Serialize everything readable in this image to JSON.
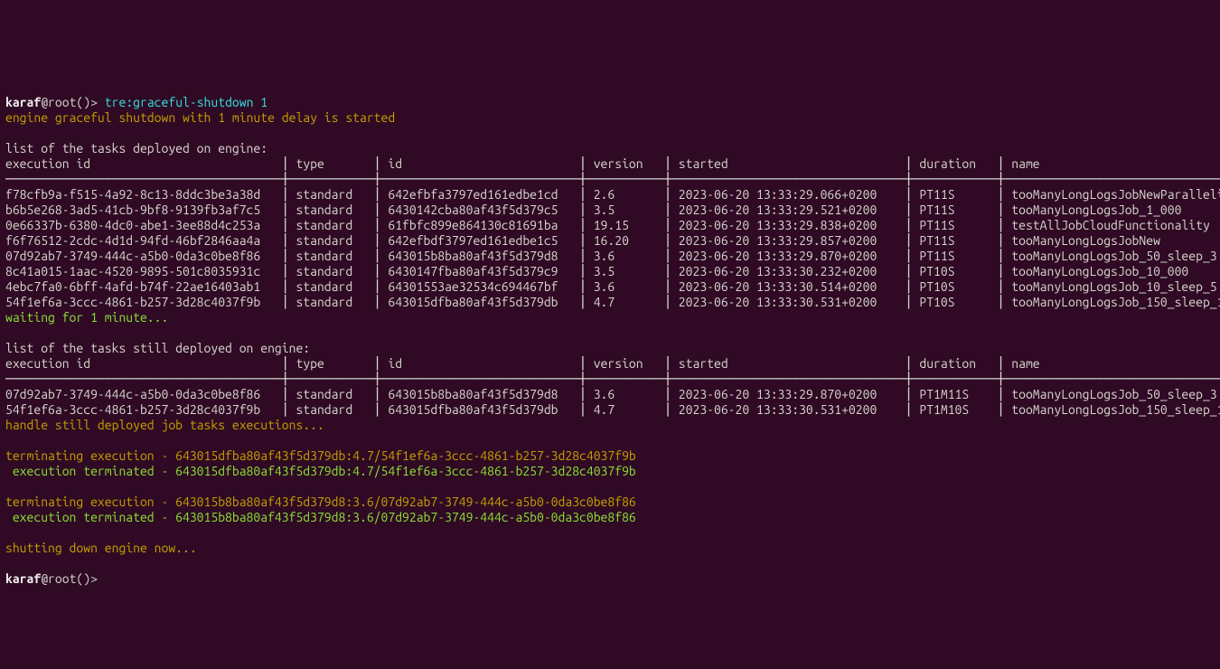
{
  "prompt": {
    "user": "karaf",
    "at": "@",
    "host": "root",
    "suffix": "()>",
    "space": " "
  },
  "cmd": {
    "text": "tre:graceful-shutdown",
    "arg": "1"
  },
  "msg": {
    "start": "engine graceful shutdown with 1 minute delay is started",
    "list1": "list of the tasks deployed on engine:",
    "waiting": "waiting for 1 minute...",
    "list2": "list of the tasks still deployed on engine:",
    "handle": "handle still deployed job tasks executions...",
    "term1a": "terminating execution - 643015dfba80af43f5d379db:4.7/54f1ef6a-3ccc-4861-b257-3d28c4037f9b",
    "term1b": " execution terminated - 643015dfba80af43f5d379db:4.7/54f1ef6a-3ccc-4861-b257-3d28c4037f9b",
    "term2a": "terminating execution - 643015b8ba80af43f5d379d8:3.6/07d92ab7-3749-444c-a5b0-0da3c0be8f86",
    "term2b": " execution terminated - 643015b8ba80af43f5d379d8:3.6/07d92ab7-3749-444c-a5b0-0da3c0be8f86",
    "shutting": "shutting down engine now..."
  },
  "hdr": {
    "exec": "execution id",
    "type": "type",
    "id": "id",
    "ver": "version",
    "started": "started",
    "dur": "duration",
    "name": "name"
  },
  "sep": {
    "long": "───────────────────────────────────────┼────────────┼────────────────────────────┼───────────┼─────────────────────────────────┼────────────┼──────────────────────────────────────",
    "tbl2": "───────────────────────────────────────┼────────────┼────────────────────────────┼───────────┼─────────────────────────────────┼────────────┼──────────────────────────────────────"
  },
  "t1": [
    {
      "exec": "f78cfb9a-f515-4a92-8c13-8ddc3be3a38d",
      "type": "standard",
      "id": "642efbfa3797ed161edbe1cd",
      "ver": "2.6",
      "started": "2023-06-20 13:33:29.066+0200",
      "dur": "PT11S",
      "name": "tooManyLongLogsJobNewParallelizeParent"
    },
    {
      "exec": "b6b5e268-3ad5-41cb-9bf8-9139fb3af7c5",
      "type": "standard",
      "id": "6430142cba80af43f5d379c5",
      "ver": "3.5",
      "started": "2023-06-20 13:33:29.521+0200",
      "dur": "PT11S",
      "name": "tooManyLongLogsJob_1_000"
    },
    {
      "exec": "0e66337b-6380-4dc0-abe1-3ee88d4c253a",
      "type": "standard",
      "id": "61fbfc899e864130c81691ba",
      "ver": "19.15",
      "started": "2023-06-20 13:33:29.838+0200",
      "dur": "PT11S",
      "name": "testAllJobCloudFunctionality"
    },
    {
      "exec": "f6f76512-2cdc-4d1d-94fd-46bf2846aa4a",
      "type": "standard",
      "id": "642efbdf3797ed161edbe1c5",
      "ver": "16.20",
      "started": "2023-06-20 13:33:29.857+0200",
      "dur": "PT11S",
      "name": "tooManyLongLogsJobNew"
    },
    {
      "exec": "07d92ab7-3749-444c-a5b0-0da3c0be8f86",
      "type": "standard",
      "id": "643015b8ba80af43f5d379d8",
      "ver": "3.6",
      "started": "2023-06-20 13:33:29.870+0200",
      "dur": "PT11S",
      "name": "tooManyLongLogsJob_50_sleep_3"
    },
    {
      "exec": "8c41a015-1aac-4520-9895-501c8035931c",
      "type": "standard",
      "id": "6430147fba80af43f5d379c9",
      "ver": "3.5",
      "started": "2023-06-20 13:33:30.232+0200",
      "dur": "PT10S",
      "name": "tooManyLongLogsJob_10_000"
    },
    {
      "exec": "4ebc7fa0-6bff-4afd-b74f-22ae16403ab1",
      "type": "standard",
      "id": "64301553ae32534c694467bf",
      "ver": "3.6",
      "started": "2023-06-20 13:33:30.514+0200",
      "dur": "PT10S",
      "name": "tooManyLongLogsJob_10_sleep_5"
    },
    {
      "exec": "54f1ef6a-3ccc-4861-b257-3d28c4037f9b",
      "type": "standard",
      "id": "643015dfba80af43f5d379db",
      "ver": "4.7",
      "started": "2023-06-20 13:33:30.531+0200",
      "dur": "PT10S",
      "name": "tooManyLongLogsJob_150_sleep_1"
    }
  ],
  "t2": [
    {
      "exec": "07d92ab7-3749-444c-a5b0-0da3c0be8f86",
      "type": "standard",
      "id": "643015b8ba80af43f5d379d8",
      "ver": "3.6",
      "started": "2023-06-20 13:33:29.870+0200",
      "dur": "PT1M11S",
      "name": "tooManyLongLogsJob_50_sleep_3"
    },
    {
      "exec": "54f1ef6a-3ccc-4861-b257-3d28c4037f9b",
      "type": "standard",
      "id": "643015dfba80af43f5d379db",
      "ver": "4.7",
      "started": "2023-06-20 13:33:30.531+0200",
      "dur": "PT1M10S",
      "name": "tooManyLongLogsJob_150_sleep_1"
    }
  ]
}
